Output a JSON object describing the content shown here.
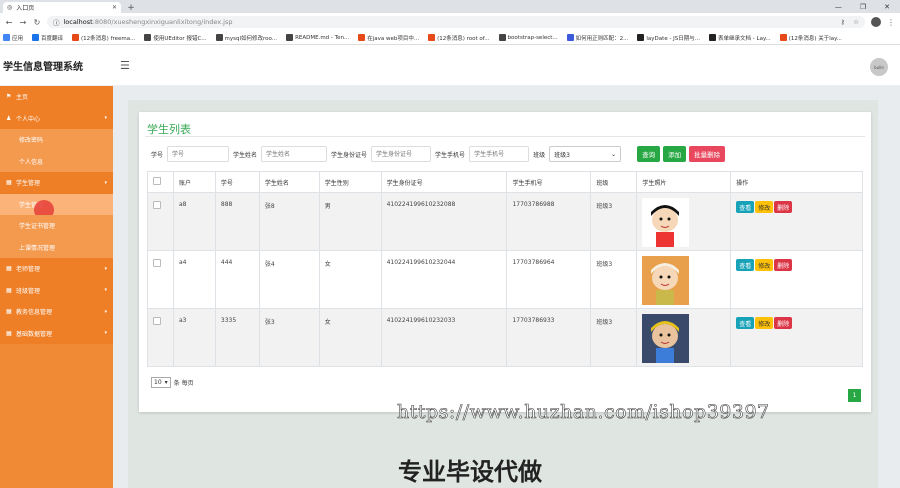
{
  "browser": {
    "tab_title": "入口页",
    "url_host": "localhost",
    "url_path": ":8080/xueshengxinxiguanlixitong/index.jsp",
    "bookmarks": [
      "应用",
      "百度翻译",
      "(12条消息) freema...",
      "使用UEditor 报错C...",
      "mysql如何修改roo...",
      "README.md - Ten...",
      "在java web项目中...",
      "(12条消息) root of...",
      "bootstrap-select...",
      "如何用正则匹配：2...",
      "layDate - JS日期与...",
      "表单继承文档 - Lay...",
      "(12条消息) 关于lay..."
    ]
  },
  "header": {
    "app_title": "学生信息管理系统",
    "user_label": "bulle"
  },
  "sidebar": {
    "items": [
      {
        "label": "主页",
        "level": "top",
        "icon": "flag-icon"
      },
      {
        "label": "个人中心",
        "level": "top",
        "icon": "user-icon",
        "expand": true
      },
      {
        "label": "修改密码",
        "level": "sub"
      },
      {
        "label": "个人信息",
        "level": "sub"
      },
      {
        "label": "学生管理",
        "level": "top",
        "icon": "grid-icon",
        "expand": true
      },
      {
        "label": "学生管理",
        "level": "sub",
        "active": true
      },
      {
        "label": "学生证书管理",
        "level": "sub"
      },
      {
        "label": "上课情况管理",
        "level": "sub"
      },
      {
        "label": "老师管理",
        "level": "top",
        "icon": "grid-icon",
        "expand": true
      },
      {
        "label": "班级管理",
        "level": "top",
        "icon": "grid-icon",
        "expand": true
      },
      {
        "label": "教务信息管理",
        "level": "top",
        "icon": "grid-icon",
        "expand": true
      },
      {
        "label": "基础数据管理",
        "level": "top",
        "icon": "grid-icon",
        "expand": true
      }
    ]
  },
  "panel": {
    "title": "学生列表",
    "search": {
      "student_no_label": "学号",
      "student_no_placeholder": "学号",
      "name_label": "学生姓名",
      "name_placeholder": "学生姓名",
      "id_label": "学生身份证号",
      "id_placeholder": "学生身份证号",
      "phone_label": "学生手机号",
      "phone_placeholder": "学生手机号",
      "class_label": "班级",
      "class_value": "班级3"
    },
    "buttons": {
      "query": "查询",
      "add": "添加",
      "batch_delete": "批量删除"
    },
    "columns": [
      "账户",
      "学号",
      "学生姓名",
      "学生性别",
      "学生身份证号",
      "学生手机号",
      "班级",
      "学生照片",
      "操作"
    ],
    "rows": [
      {
        "account": "a8",
        "no": "888",
        "name": "张8",
        "gender": "男",
        "id": "410224199610232088",
        "phone": "17703786988",
        "class": "班级3"
      },
      {
        "account": "a4",
        "no": "444",
        "name": "张4",
        "gender": "女",
        "id": "410224199610232044",
        "phone": "17703786964",
        "class": "班级3"
      },
      {
        "account": "a3",
        "no": "3335",
        "name": "张3",
        "gender": "女",
        "id": "410224199610232033",
        "phone": "17703786933",
        "class": "班级3"
      }
    ],
    "row_actions": {
      "view": "查看",
      "edit": "修改",
      "delete": "删除"
    },
    "pager": {
      "page_size": "10",
      "per_page_suffix": "条 每页",
      "current_page": "1"
    }
  },
  "overlay": {
    "watermark": "https://www.huzhan.com/ishop39397",
    "caption": "专业毕设代做"
  }
}
